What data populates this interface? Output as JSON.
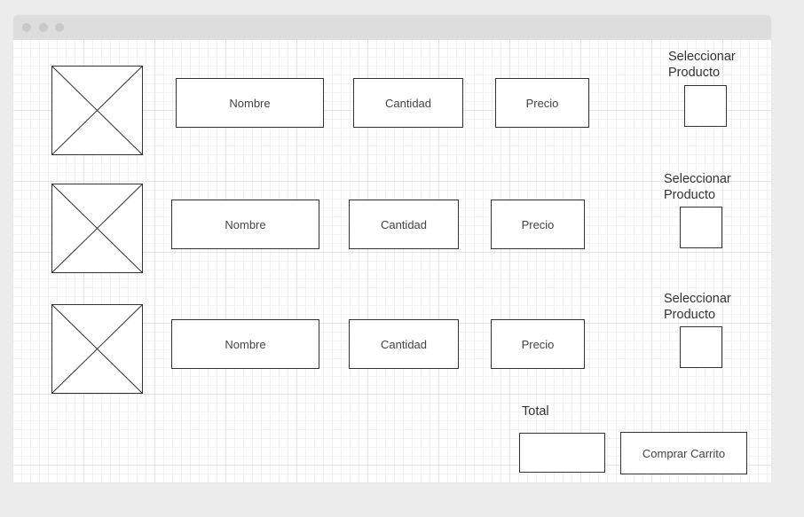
{
  "products": [
    {
      "name_label": "Nombre",
      "quantity_label": "Cantidad",
      "price_label": "Precio",
      "select_label_line1": "Seleccionar",
      "select_label_line2": "Producto"
    },
    {
      "name_label": "Nombre",
      "quantity_label": "Cantidad",
      "price_label": "Precio",
      "select_label_line1": "Seleccionar",
      "select_label_line2": "Producto"
    },
    {
      "name_label": "Nombre",
      "quantity_label": "Cantidad",
      "price_label": "Precio",
      "select_label_line1": "Seleccionar",
      "select_label_line2": "Producto"
    }
  ],
  "summary": {
    "total_label": "Total",
    "total_value": "",
    "buy_button_label": "Comprar Carrito"
  },
  "colors": {
    "stroke": "#333333",
    "grid": "#e3e3e3",
    "window_chrome": "#dddddd"
  }
}
